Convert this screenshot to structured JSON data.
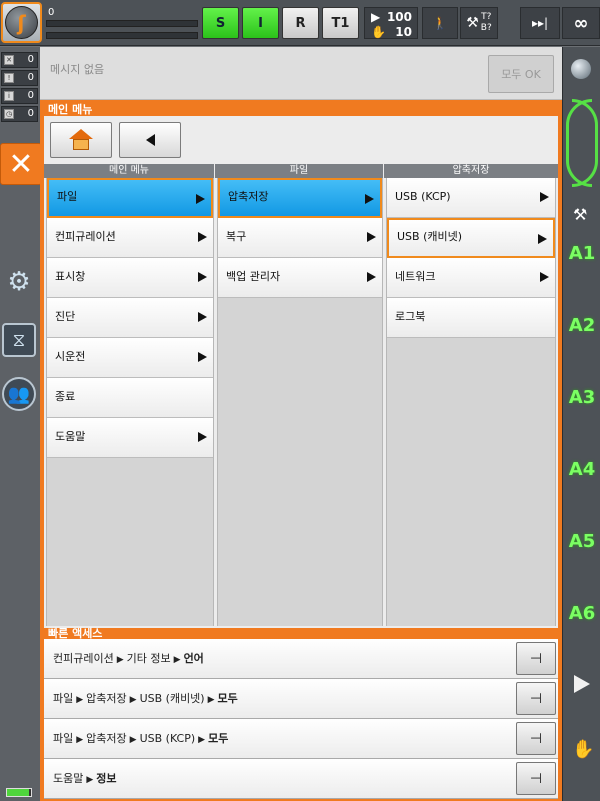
{
  "topbar": {
    "robot_glyph": "ʃ",
    "program_progress": "0",
    "status_buttons": [
      "S",
      "I",
      "R",
      "T1"
    ],
    "status_colors": {
      "active": "#2bc21a",
      "inactive": "#c9c9c9"
    },
    "speed_override": "100",
    "jog_override": "10",
    "tool_line1": "T?",
    "tool_line2": "B?",
    "increment": "∞"
  },
  "leftbar": {
    "counters": [
      "0",
      "0",
      "0",
      "0"
    ],
    "close_glyph": "✕"
  },
  "message": {
    "text": "메시지 없음",
    "ack_all_label": "모두 OK"
  },
  "main_menu": {
    "title": "메인 메뉴",
    "columns": [
      {
        "header": "메인 메뉴",
        "items": [
          {
            "label": "파일",
            "submenu": true,
            "selected": true
          },
          {
            "label": "컨피규레이션",
            "submenu": true
          },
          {
            "label": "표시창",
            "submenu": true
          },
          {
            "label": "진단",
            "submenu": true
          },
          {
            "label": "시운전",
            "submenu": true
          },
          {
            "label": "종료",
            "submenu": false
          },
          {
            "label": "도움말",
            "submenu": true
          }
        ]
      },
      {
        "header": "파일",
        "items": [
          {
            "label": "압축저장",
            "submenu": true,
            "selected": true
          },
          {
            "label": "복구",
            "submenu": true
          },
          {
            "label": "백업 관리자",
            "submenu": true
          }
        ]
      },
      {
        "header": "압축저장",
        "items": [
          {
            "label": "USB (KCP)",
            "submenu": true
          },
          {
            "label": "USB (캐비넷)",
            "submenu": true,
            "highlighted": true
          },
          {
            "label": "네트워크",
            "submenu": true
          },
          {
            "label": "로그북",
            "submenu": false
          }
        ]
      }
    ]
  },
  "quick_access": {
    "title": "빠른 액세스",
    "rows": [
      {
        "path": [
          "컨피규레이션",
          "기타 정보"
        ],
        "last": "언어"
      },
      {
        "path": [
          "파일",
          "압축저장",
          "USB (캐비넷)"
        ],
        "last": "모두"
      },
      {
        "path": [
          "파일",
          "압축저장",
          "USB (KCP)"
        ],
        "last": "모두"
      },
      {
        "path": [
          "도움말"
        ],
        "last": "정보"
      }
    ],
    "path_separator": "▶"
  },
  "rightbar": {
    "axes": [
      "A1",
      "A2",
      "A3",
      "A4",
      "A5",
      "A6"
    ],
    "accent_color": "#56e045"
  }
}
